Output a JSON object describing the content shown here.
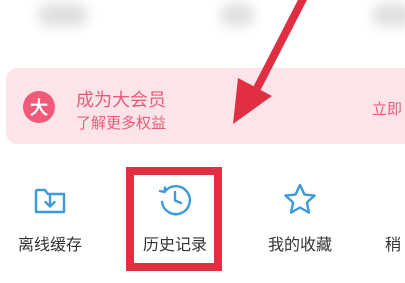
{
  "vip_banner": {
    "badge_char": "大",
    "title": "成为大会员",
    "subtitle": "了解更多权益",
    "action_label": "立即"
  },
  "menu": {
    "items": [
      {
        "label": "离线缓存",
        "icon": "download-folder-icon"
      },
      {
        "label": "历史记录",
        "icon": "history-clock-icon"
      },
      {
        "label": "我的收藏",
        "icon": "star-icon"
      },
      {
        "label": "稍",
        "icon": ""
      }
    ]
  },
  "colors": {
    "accent": "#3b9ad9",
    "vip_pink": "#f05a78",
    "vip_bg": "#fde4e9",
    "annotation_red": "#e02f42"
  }
}
